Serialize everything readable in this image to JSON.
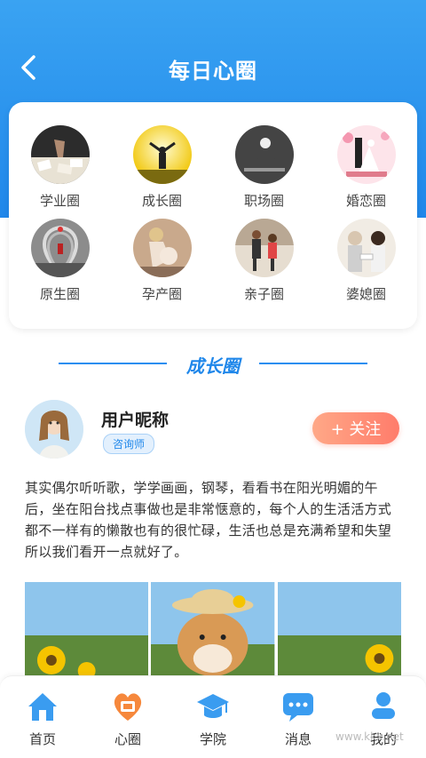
{
  "header": {
    "title": "每日心圈",
    "back_icon": "chevron-left-icon",
    "color_top": "#3aa3f2",
    "color_bottom": "#1f87ea"
  },
  "categories": [
    {
      "label": "学业圈"
    },
    {
      "label": "成长圈"
    },
    {
      "label": "职场圈"
    },
    {
      "label": "婚恋圈"
    },
    {
      "label": "原生圈"
    },
    {
      "label": "孕产圈"
    },
    {
      "label": "亲子圈"
    },
    {
      "label": "婆媳圈"
    }
  ],
  "section": {
    "title": "成长圈"
  },
  "post": {
    "username": "用户昵称",
    "badge": "咨询师",
    "follow_label": "+ 关注",
    "text": "其实偶尔听听歌，学学画画，钢琴，看看书在阳光明媚的午后，坐在阳台找点事做也是非常惬意的，每个人的生活活方式都不一样有的懒散也有的很忙碌，生活也总是充满希望和失望所以我们看开一点就好了。"
  },
  "tabbar": {
    "items": [
      {
        "label": "首页",
        "icon": "home-icon"
      },
      {
        "label": "心圈",
        "icon": "heart-icon"
      },
      {
        "label": "学院",
        "icon": "graduation-cap-icon"
      },
      {
        "label": "消息",
        "icon": "message-icon"
      },
      {
        "label": "我的",
        "icon": "user-icon"
      }
    ]
  },
  "watermark": "www.kkx.net"
}
